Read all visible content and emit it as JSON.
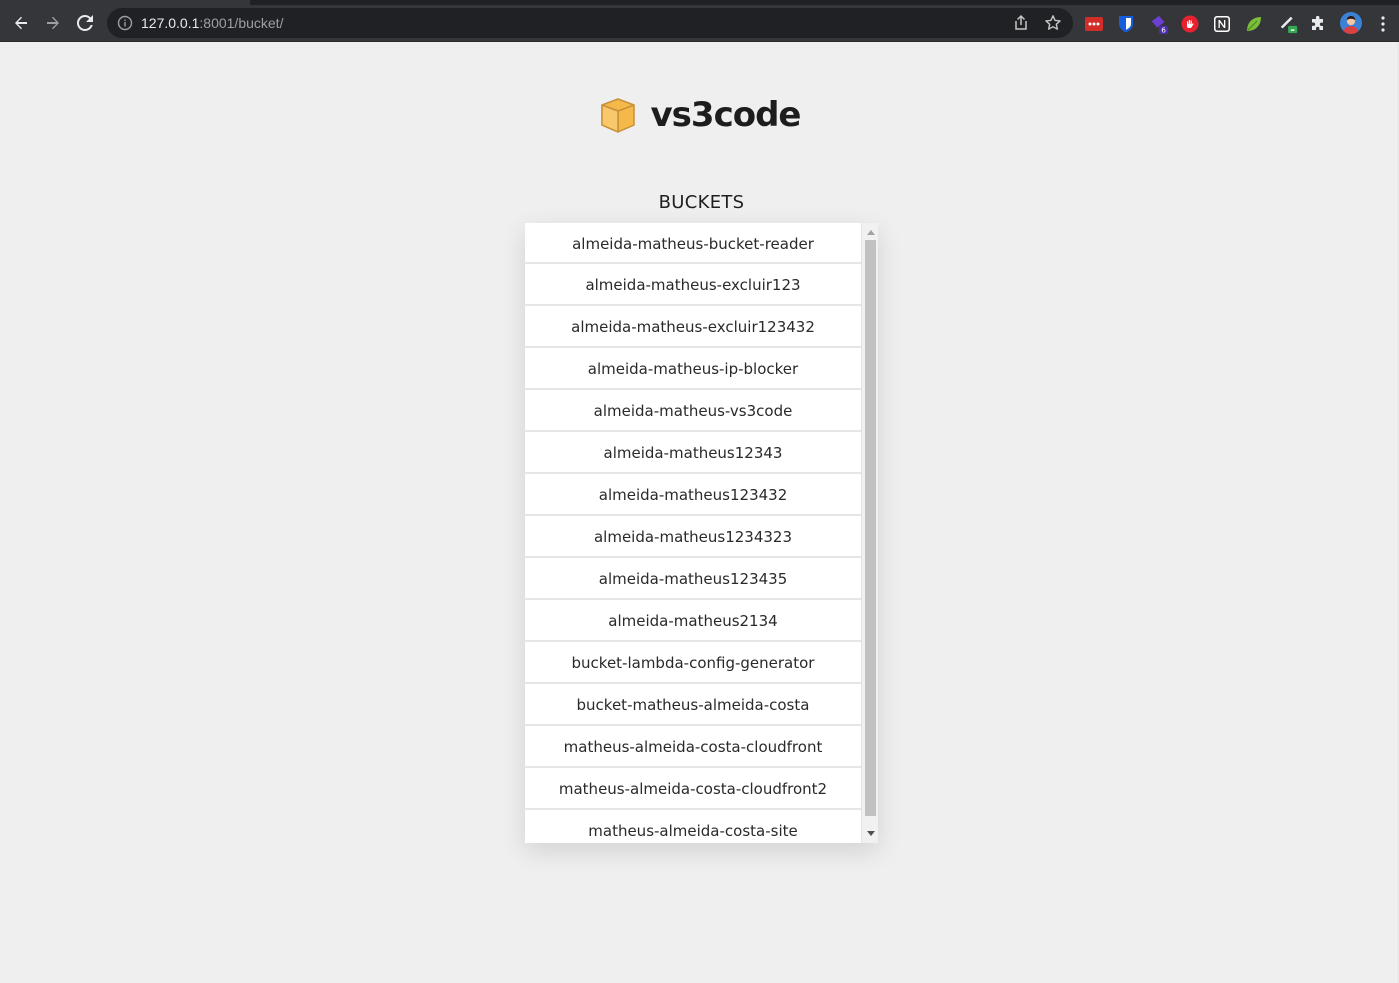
{
  "browser": {
    "url_host": "127.0.0.1",
    "url_path": ":8001/bucket/",
    "extensions": [
      {
        "name": "lastpass-icon",
        "color": "#d32d27"
      },
      {
        "name": "bitwarden-icon",
        "color": "#175ddc"
      },
      {
        "name": "extension-purple-icon",
        "color": "#6b3fd4",
        "badge": "6"
      },
      {
        "name": "ublock-icon",
        "color": "#e8212f"
      },
      {
        "name": "notion-icon",
        "color": "#ffffff"
      },
      {
        "name": "leaf-icon",
        "color": "#7cbf3a"
      },
      {
        "name": "pen-icon",
        "color": "#34a853"
      }
    ]
  },
  "app": {
    "logo_title": "vs3code",
    "logo_color": "#f5b94a"
  },
  "buckets": {
    "heading": "BUCKETS",
    "items": [
      "almeida-matheus-bucket-reader",
      "almeida-matheus-excluir123",
      "almeida-matheus-excluir123432",
      "almeida-matheus-ip-blocker",
      "almeida-matheus-vs3code",
      "almeida-matheus12343",
      "almeida-matheus123432",
      "almeida-matheus1234323",
      "almeida-matheus123435",
      "almeida-matheus2134",
      "bucket-lambda-config-generator",
      "bucket-matheus-almeida-costa",
      "matheus-almeida-costa-cloudfront",
      "matheus-almeida-costa-cloudfront2",
      "matheus-almeida-costa-site"
    ]
  }
}
